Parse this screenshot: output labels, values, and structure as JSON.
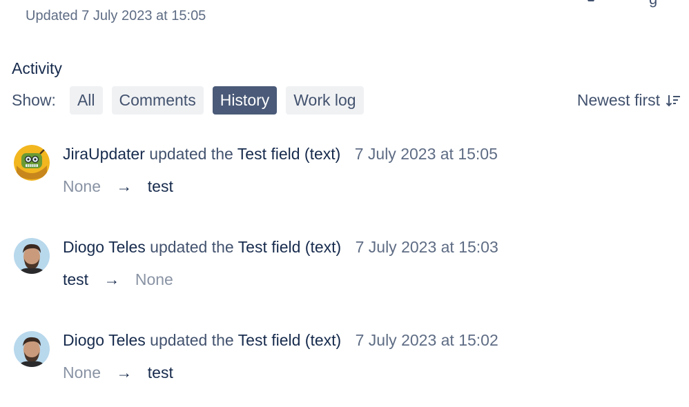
{
  "issue": {
    "updated_text": "Updated 7 July 2023 at 15:05",
    "top_right_cut_text": "g"
  },
  "activity": {
    "title": "Activity",
    "show_label": "Show:",
    "tabs": [
      {
        "label": "All",
        "active": false
      },
      {
        "label": "Comments",
        "active": false
      },
      {
        "label": "History",
        "active": true
      },
      {
        "label": "Work log",
        "active": false
      }
    ],
    "sort_label": "Newest first",
    "sort_icon": "sort-descending-icon",
    "entries": [
      {
        "actor": "JiraUpdater",
        "action": "updated the",
        "field": "Test field (text)",
        "time": "7 July 2023 at 15:05",
        "old_value": "None",
        "arrow": "→",
        "new_value": "test",
        "avatar": "robot-avatar"
      },
      {
        "actor": "Diogo Teles",
        "action": "updated the",
        "field": "Test field (text)",
        "time": "7 July 2023 at 15:03",
        "old_value": "test",
        "arrow": "→",
        "new_value": "None",
        "avatar": "user-photo-avatar"
      },
      {
        "actor": "Diogo Teles",
        "action": "updated the",
        "field": "Test field (text)",
        "time": "7 July 2023 at 15:02",
        "old_value": "None",
        "arrow": "→",
        "new_value": "test",
        "avatar": "user-photo-avatar"
      }
    ]
  },
  "colors": {
    "text_primary": "#172b4d",
    "text_secondary": "#42526e",
    "text_muted": "#8993a4",
    "tab_bg": "#f0f1f3",
    "tab_active_bg": "#4a5a78",
    "tab_active_text": "#ffffff"
  }
}
